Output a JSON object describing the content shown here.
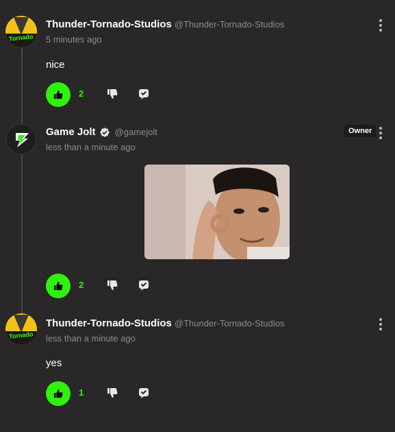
{
  "comments": [
    {
      "display_name": "Thunder-Tornado-Studios",
      "handle": "@Thunder-Tornado-Studios",
      "time": "5 minutes ago",
      "text": "nice",
      "likes": "2",
      "avatar_text": "Tornado",
      "liked": true
    },
    {
      "display_name": "Game Jolt",
      "handle": "@gamejolt",
      "time": "less than a minute ago",
      "badge": "Owner",
      "verified": true,
      "likes": "2",
      "liked": true,
      "attachment": "reaction-gif"
    },
    {
      "display_name": "Thunder-Tornado-Studios",
      "handle": "@Thunder-Tornado-Studios",
      "time": "less than a minute ago",
      "text": "yes",
      "likes": "1",
      "avatar_text": "Tornado",
      "liked": true
    }
  ],
  "colors": {
    "background": "#2a2729",
    "like_green": "#2ff20c",
    "muted_text": "#8e8b90"
  },
  "icons": {
    "like": "thumbs-up-icon",
    "dislike": "thumbs-down-icon",
    "reply": "reply-icon",
    "more": "kebab-menu-icon",
    "verified": "verified-badge-icon"
  }
}
